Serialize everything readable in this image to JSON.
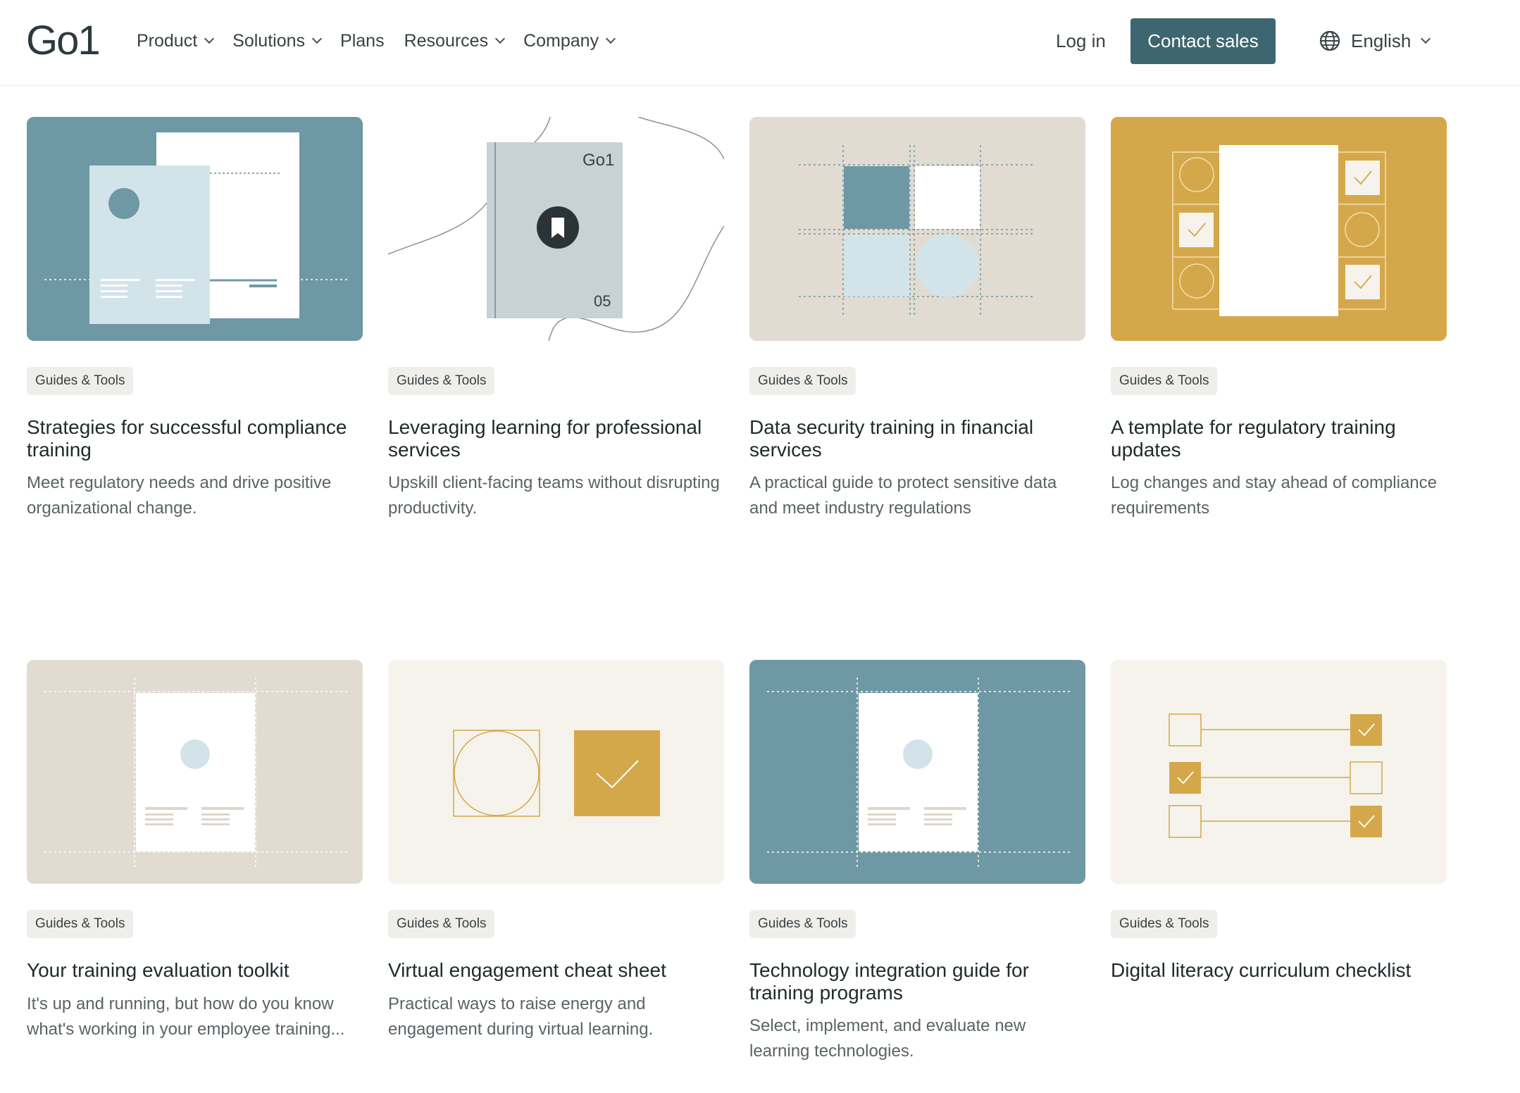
{
  "header": {
    "logo": "Go1",
    "nav": [
      {
        "label": "Product",
        "has_menu": true
      },
      {
        "label": "Solutions",
        "has_menu": true
      },
      {
        "label": "Plans",
        "has_menu": false
      },
      {
        "label": "Resources",
        "has_menu": true
      },
      {
        "label": "Company",
        "has_menu": true
      }
    ],
    "login": "Log in",
    "contact": "Contact sales",
    "language": "English"
  },
  "thumb_text": {
    "book_logo": "Go1",
    "book_number": "05"
  },
  "colors": {
    "teal": "#6e98a4",
    "gold": "#d4a84a",
    "beige": "#e2dbd1",
    "cream": "#f6f3ec",
    "button": "#3e6670"
  },
  "cards": [
    {
      "tag": "Guides & Tools",
      "title": "Strategies for successful compliance training",
      "desc": "Meet regulatory needs and drive positive organizational change."
    },
    {
      "tag": "Guides & Tools",
      "title": "Leveraging learning for professional services",
      "desc": "Upskill client-facing teams without disrupting productivity."
    },
    {
      "tag": "Guides & Tools",
      "title": "Data security training in financial services",
      "desc": "A practical guide to protect sensitive data and meet industry regulations"
    },
    {
      "tag": "Guides & Tools",
      "title": "A template for regulatory training updates",
      "desc": "Log changes and stay ahead of compliance requirements"
    },
    {
      "tag": "Guides & Tools",
      "title": "Your training evaluation toolkit",
      "desc": "It's up and running, but how do you know what's working in your employee training..."
    },
    {
      "tag": "Guides & Tools",
      "title": "Virtual engagement cheat sheet",
      "desc": "Practical ways to raise energy and engagement during virtual learning."
    },
    {
      "tag": "Guides & Tools",
      "title": "Technology integration guide for training programs",
      "desc": "Select, implement, and evaluate new learning technologies."
    },
    {
      "tag": "Guides & Tools",
      "title": "Digital literacy curriculum checklist",
      "desc": ""
    }
  ]
}
